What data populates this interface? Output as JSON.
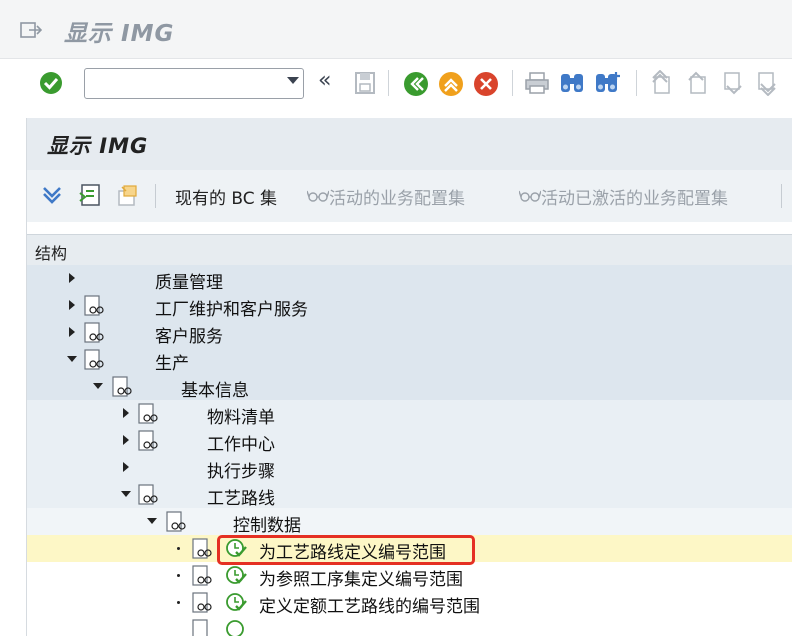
{
  "window": {
    "title": "显示 IMG"
  },
  "toolbar": {
    "command_field_value": "",
    "back_symbol": "«"
  },
  "panel": {
    "title": "显示 IMG",
    "tools": {
      "existing_bc_sets": "现有的 BC 集",
      "active_bc_sets": "活动的业务配置集",
      "activated_bc_sets": "活动已激活的业务配置集"
    },
    "structure_label": "结构"
  },
  "tree": {
    "quality": "质量管理",
    "plant_maint": "工厂维护和客户服务",
    "customer_service": "客户服务",
    "production": "生产",
    "basic_data": "基本信息",
    "bom": "物料清单",
    "work_center": "工作中心",
    "exec_steps": "执行步骤",
    "routings": "工艺路线",
    "control_data": "控制数据",
    "define_number_range": "为工艺路线定义编号范围",
    "ref_op_set_range": "为参照工序集定义编号范围",
    "rate_routing_range": "定义定额工艺路线的编号范围"
  },
  "colors": {
    "highlight_row": "#fdf7c6",
    "focus_border": "#e53023",
    "enter_green": "#3a9b2f",
    "nav_orange": "#f0a01c",
    "cancel_red": "#d9442c"
  }
}
